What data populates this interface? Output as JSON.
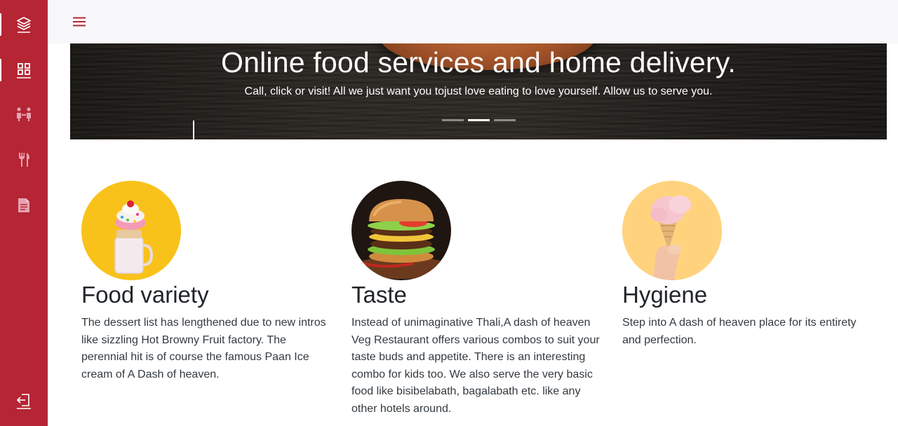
{
  "sidebar": {
    "items": [
      {
        "icon": "layers-icon",
        "active": true
      },
      {
        "icon": "grid-icon",
        "active": true
      },
      {
        "icon": "people-icon",
        "active": false
      },
      {
        "icon": "utensils-icon",
        "active": false
      },
      {
        "icon": "document-icon",
        "active": false
      }
    ],
    "logout_icon": "logout-icon",
    "background": "#b52533"
  },
  "topbar": {
    "menu_icon": "hamburger-icon",
    "accent": "#b52533"
  },
  "hero": {
    "title": "Online food services and home delivery.",
    "subtitle": "Call, click or visit! All we just want you tojust love eating to love yourself. Allow us to serve you.",
    "indicators": [
      {
        "active": false
      },
      {
        "active": true
      },
      {
        "active": false
      }
    ]
  },
  "features": [
    {
      "title": "Food variety",
      "text": "The dessert list has lengthened due to new intros like sizzling Hot Browny Fruit factory. The perennial hit is of course the famous Paan Ice cream of A Dash of heaven.",
      "image": "milkshake-dessert"
    },
    {
      "title": "Taste",
      "text": "Instead of unimaginative Thali,A dash of heaven Veg Restaurant offers various combos to suit your taste buds and appetite. There is an interesting combo for kids too. We also serve the very basic food like bisibelabath, bagalabath etc. like any other hotels around.",
      "image": "burger"
    },
    {
      "title": "Hygiene",
      "text": "Step into A dash of heaven place for its entirety and perfection.",
      "image": "ice-cream-cone"
    }
  ]
}
